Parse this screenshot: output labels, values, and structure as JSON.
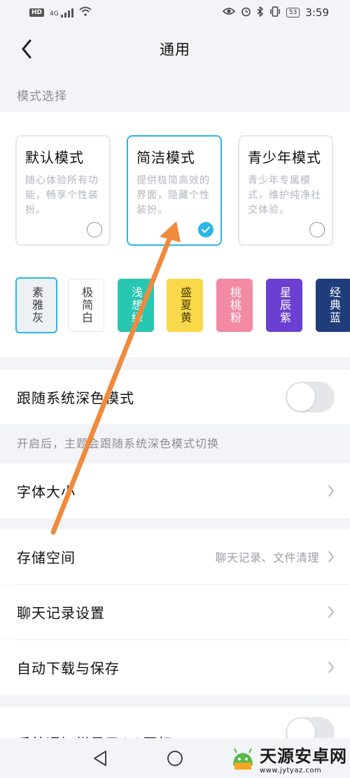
{
  "status_bar": {
    "hd": "HD",
    "signal": "4G",
    "battery": "53",
    "time": "3:59"
  },
  "header": {
    "title": "通用"
  },
  "mode_section": {
    "label": "模式选择",
    "cards": [
      {
        "title": "默认模式",
        "desc": "随心体验所有功能，畅享个性装扮。",
        "selected": false
      },
      {
        "title": "简洁模式",
        "desc": "提供极简高效的界面，隐藏个性装扮。",
        "selected": true
      },
      {
        "title": "青少年模式",
        "desc": "青少年专属模式，维护纯净社交体验。",
        "selected": false
      }
    ],
    "themes": [
      {
        "name": "素雅灰",
        "color": "#eef1f4",
        "text_color": "#3d3d3d",
        "selected": true
      },
      {
        "name": "极简白",
        "color": "#ffffff",
        "text_color": "#3d3d3d",
        "selected": false
      },
      {
        "name": "浅想绿",
        "color": "#27c7b2",
        "text_color": "#ffffff",
        "selected": false
      },
      {
        "name": "盛夏黄",
        "color": "#f9d84a",
        "text_color": "#4a3a00",
        "selected": false
      },
      {
        "name": "桃桃粉",
        "color": "#f38aa5",
        "text_color": "#ffffff",
        "selected": false
      },
      {
        "name": "星辰紫",
        "color": "#6a3fd1",
        "text_color": "#ffffff",
        "selected": false
      },
      {
        "name": "经典蓝",
        "color": "#1e3d7a",
        "text_color": "#ffffff",
        "selected": false
      }
    ]
  },
  "dark_mode": {
    "label": "跟随系统深色模式",
    "enabled": false,
    "hint": "开启后，主题会跟随系统深色模式切换"
  },
  "font_size": {
    "label": "字体大小"
  },
  "storage": {
    "label": "存储空间",
    "value": "聊天记录、文件清理"
  },
  "chat_history": {
    "label": "聊天记录设置"
  },
  "auto_download": {
    "label": "自动下载与保存"
  },
  "notification": {
    "label": "系统通知栏显示QQ图标",
    "enabled": false
  },
  "watermark": {
    "main": "天源安卓网",
    "sub": "www.jytyaz.com"
  },
  "colors": {
    "accent": "#2bb6e3",
    "annotation_arrow": "#f08a3c"
  }
}
